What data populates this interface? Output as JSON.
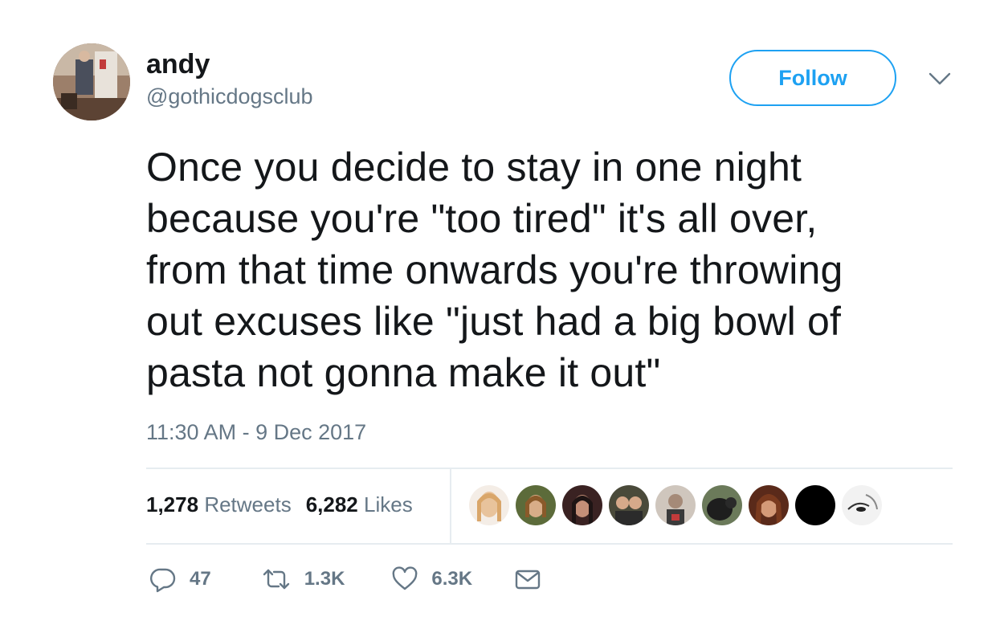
{
  "user": {
    "display_name": "andy",
    "handle": "@gothicdogsclub"
  },
  "follow_button": {
    "label": "Follow"
  },
  "tweet": {
    "text_lines": [
      "Once you decide to stay in one night",
      "because you're \"too tired\" it's all over,",
      "from that time onwards you're throwing",
      "out excuses like \"just had a big bowl of",
      "pasta not gonna make it out\""
    ],
    "timestamp": "11:30 AM - 9 Dec 2017"
  },
  "stats": {
    "retweets_count": "1,278",
    "retweets_label": "Retweets",
    "likes_count": "6,282",
    "likes_label": "Likes"
  },
  "liker_avatars": [
    {
      "name": "liker-avatar-1",
      "color": "#e9c39c"
    },
    {
      "name": "liker-avatar-2",
      "color": "#6b5a3a"
    },
    {
      "name": "liker-avatar-3",
      "color": "#5a2f2f"
    },
    {
      "name": "liker-avatar-4",
      "color": "#4a4a3a"
    },
    {
      "name": "liker-avatar-5",
      "color": "#7a6e66"
    },
    {
      "name": "liker-avatar-6",
      "color": "#3f4a3a"
    },
    {
      "name": "liker-avatar-7",
      "color": "#6b3a28"
    },
    {
      "name": "liker-avatar-8",
      "color": "#000000"
    },
    {
      "name": "liker-avatar-9",
      "color": "#f0f0f0"
    }
  ],
  "actions": {
    "reply_count": "47",
    "retweet_count": "1.3K",
    "like_count": "6.3K"
  },
  "colors": {
    "accent": "#1da1f2",
    "text_primary": "#14171a",
    "text_secondary": "#657786",
    "divider": "#e6ecf0"
  },
  "icons": {
    "reply": "reply-icon",
    "retweet": "retweet-icon",
    "like": "heart-icon",
    "message": "envelope-icon",
    "caret": "chevron-down-icon"
  }
}
